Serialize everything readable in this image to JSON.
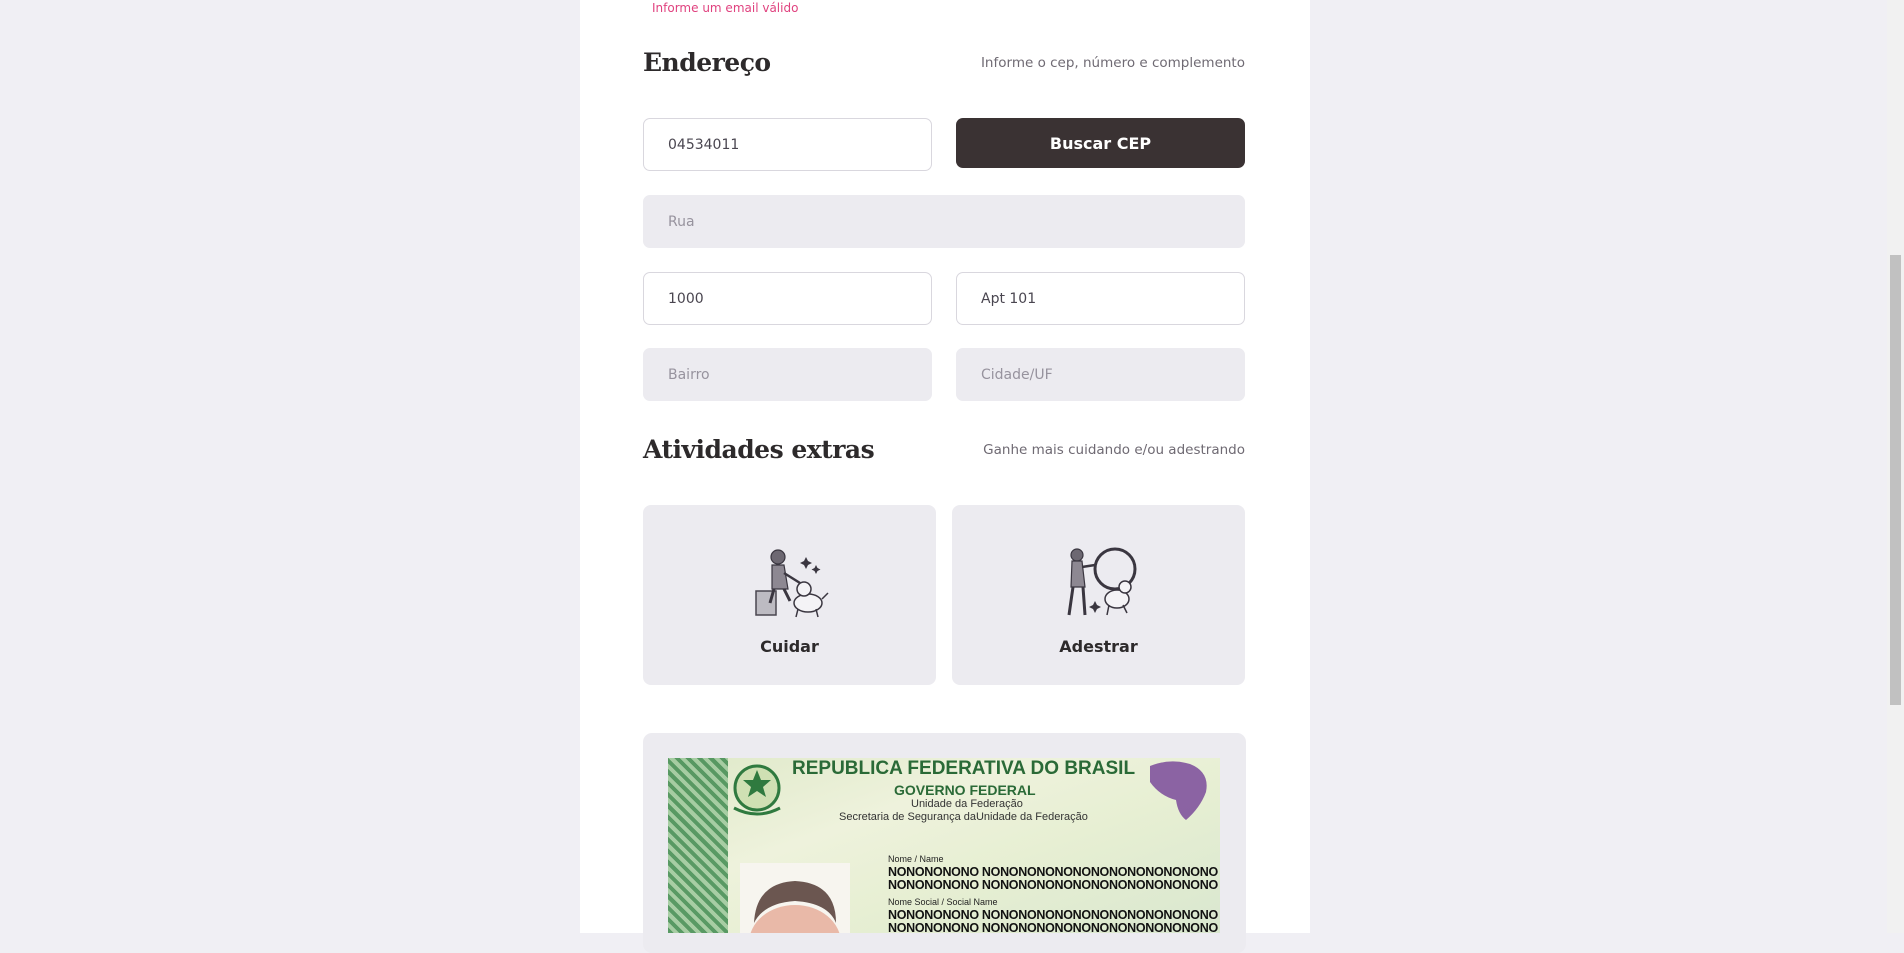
{
  "email_error": "Informe um email válido",
  "address": {
    "title": "Endereço",
    "hint": "Informe o cep, número e complemento",
    "cep_value": "04534011",
    "search_button": "Buscar CEP",
    "street_placeholder": "Rua",
    "number_value": "1000",
    "complement_value": "Apt 101",
    "neighborhood_placeholder": "Bairro",
    "city_placeholder": "Cidade/UF"
  },
  "extras": {
    "title": "Atividades extras",
    "hint": "Ganhe mais cuidando e/ou adestrando",
    "options": [
      {
        "label": "Cuidar",
        "icon": "pet-sitting-illustration"
      },
      {
        "label": "Adestrar",
        "icon": "dog-training-illustration"
      }
    ]
  },
  "document": {
    "country": "REPUBLICA FEDERATIVA DO BRASIL",
    "government": "GOVERNO FEDERAL",
    "unit": "Unidade da Federação",
    "secretariat": "Secretaria de Segurança daUnidade da Federação",
    "name_label": "Nome / Name",
    "name_line1": "NONONONONO NONONONONONONONONONONONONO",
    "name_line2": "NONONONONO NONONONONONONONONONONONONO",
    "social_name_label": "Nome Social / Social Name",
    "social_line1": "NONONONONO NONONONONONONONONONONONONO",
    "social_line2": "NONONONONO NONONONONONONONONONONONONO"
  },
  "colors": {
    "accent_dark": "#3a3233",
    "error": "#e0427f",
    "page_bg": "#f0eff4",
    "card_bg": "#ecebf0"
  }
}
